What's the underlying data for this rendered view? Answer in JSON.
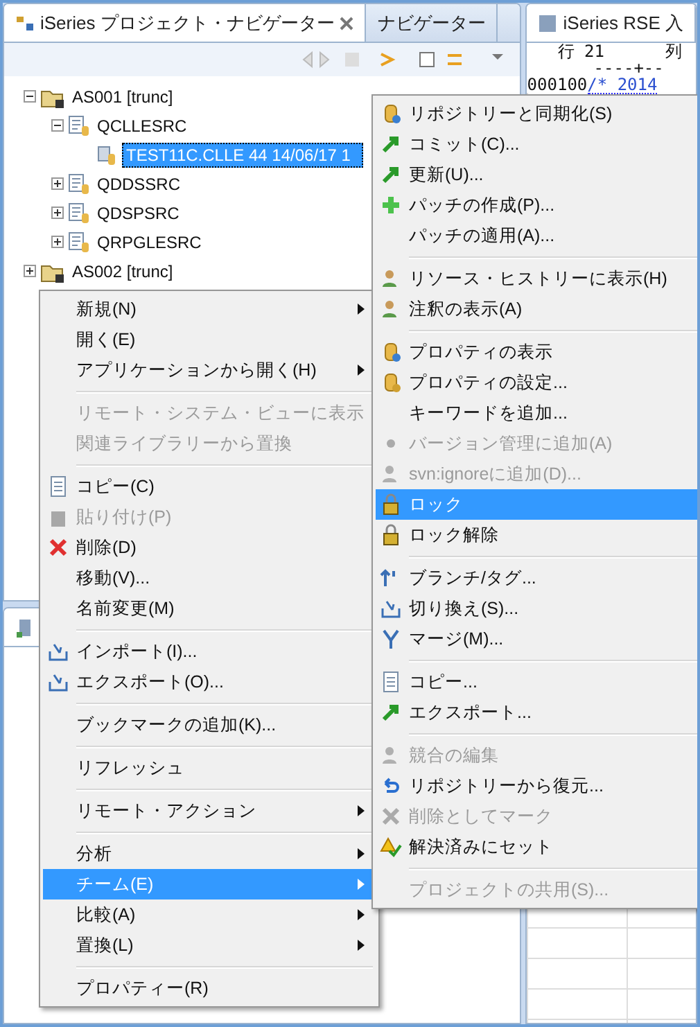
{
  "navigator": {
    "title": "iSeries プロジェクト・ナビゲーター",
    "other_tab": "ナビゲーター",
    "tree": [
      {
        "label": "AS001 [trunc]",
        "kind": "project",
        "expanded": true,
        "selected": false,
        "children": [
          {
            "label": "QCLLESRC",
            "kind": "folder",
            "expanded": true,
            "selected": false,
            "children": [
              {
                "label": "TEST11C.CLLE 44  14/06/17 1",
                "kind": "file",
                "selected": true
              }
            ]
          },
          {
            "label": "QDDSSRC",
            "kind": "folder",
            "expanded": false,
            "selected": false
          },
          {
            "label": "QDSPSRC",
            "kind": "folder",
            "expanded": false,
            "selected": false
          },
          {
            "label": "QRPGLESRC",
            "kind": "folder",
            "expanded": false,
            "selected": false
          }
        ]
      },
      {
        "label": "AS002 [trunc]",
        "kind": "project",
        "expanded": false,
        "selected": false
      }
    ]
  },
  "editor": {
    "title": "iSeries RSE 入",
    "line_label": "行 21",
    "column_label": "列",
    "ruler": "----+--",
    "sequence": "000100",
    "code": "/* 2014"
  },
  "context_menu": {
    "groups": [
      [
        {
          "label": "新規(N)",
          "disabled": false,
          "submenu": true,
          "selected": false
        },
        {
          "label": "開く(E)",
          "disabled": false,
          "submenu": false,
          "selected": false
        },
        {
          "label": "アプリケーションから開く(H)",
          "disabled": false,
          "submenu": true,
          "selected": false
        }
      ],
      [
        {
          "label": "リモート・システム・ビューに表示",
          "disabled": true,
          "submenu": false,
          "selected": false
        },
        {
          "label": "関連ライブラリーから置換",
          "disabled": true,
          "submenu": false,
          "selected": false
        }
      ],
      [
        {
          "label": "コピー(C)",
          "disabled": false,
          "submenu": false,
          "selected": false
        },
        {
          "label": "貼り付け(P)",
          "disabled": true,
          "submenu": false,
          "selected": false
        },
        {
          "label": "削除(D)",
          "disabled": false,
          "submenu": false,
          "selected": false
        },
        {
          "label": "移動(V)...",
          "disabled": false,
          "submenu": false,
          "selected": false
        },
        {
          "label": "名前変更(M)",
          "disabled": false,
          "submenu": false,
          "selected": false
        }
      ],
      [
        {
          "label": "インポート(I)...",
          "disabled": false,
          "submenu": false,
          "selected": false
        },
        {
          "label": "エクスポート(O)...",
          "disabled": false,
          "submenu": false,
          "selected": false
        }
      ],
      [
        {
          "label": "ブックマークの追加(K)...",
          "disabled": false,
          "submenu": false,
          "selected": false
        }
      ],
      [
        {
          "label": "リフレッシュ",
          "disabled": false,
          "submenu": false,
          "selected": false
        }
      ],
      [
        {
          "label": "リモート・アクション",
          "disabled": false,
          "submenu": true,
          "selected": false
        }
      ],
      [
        {
          "label": "分析",
          "disabled": false,
          "submenu": true,
          "selected": false
        },
        {
          "label": "チーム(E)",
          "disabled": false,
          "submenu": true,
          "selected": true
        },
        {
          "label": "比較(A)",
          "disabled": false,
          "submenu": true,
          "selected": false
        },
        {
          "label": "置換(L)",
          "disabled": false,
          "submenu": true,
          "selected": false
        }
      ],
      [
        {
          "label": "プロパティー(R)",
          "disabled": false,
          "submenu": false,
          "selected": false
        }
      ]
    ]
  },
  "team_submenu": {
    "groups": [
      [
        {
          "label": "リポジトリーと同期化(S)",
          "disabled": false,
          "selected": false
        },
        {
          "label": "コミット(C)...",
          "disabled": false,
          "selected": false
        },
        {
          "label": "更新(U)...",
          "disabled": false,
          "selected": false
        },
        {
          "label": "パッチの作成(P)...",
          "disabled": false,
          "selected": false
        },
        {
          "label": "パッチの適用(A)...",
          "disabled": false,
          "selected": false
        }
      ],
      [
        {
          "label": "リソース・ヒストリーに表示(H)",
          "disabled": false,
          "selected": false
        },
        {
          "label": "注釈の表示(A)",
          "disabled": false,
          "selected": false
        }
      ],
      [
        {
          "label": "プロパティの表示",
          "disabled": false,
          "selected": false
        },
        {
          "label": "プロパティの設定...",
          "disabled": false,
          "selected": false
        },
        {
          "label": "キーワードを追加...",
          "disabled": false,
          "selected": false
        },
        {
          "label": "バージョン管理に追加(A)",
          "disabled": true,
          "selected": false
        },
        {
          "label": "svn:ignoreに追加(D)...",
          "disabled": true,
          "selected": false
        },
        {
          "label": "ロック",
          "disabled": false,
          "selected": true
        },
        {
          "label": "ロック解除",
          "disabled": false,
          "selected": false
        }
      ],
      [
        {
          "label": "ブランチ/タグ...",
          "disabled": false,
          "selected": false
        },
        {
          "label": "切り換え(S)...",
          "disabled": false,
          "selected": false
        },
        {
          "label": "マージ(M)...",
          "disabled": false,
          "selected": false
        }
      ],
      [
        {
          "label": "コピー...",
          "disabled": false,
          "selected": false
        },
        {
          "label": "エクスポート...",
          "disabled": false,
          "selected": false
        }
      ],
      [
        {
          "label": "競合の編集",
          "disabled": true,
          "selected": false
        },
        {
          "label": "リポジトリーから復元...",
          "disabled": false,
          "selected": false
        },
        {
          "label": "削除としてマーク",
          "disabled": true,
          "selected": false
        },
        {
          "label": "解決済みにセット",
          "disabled": false,
          "selected": false
        }
      ],
      [
        {
          "label": "プロジェクトの共用(S)...",
          "disabled": true,
          "selected": false
        }
      ]
    ]
  }
}
